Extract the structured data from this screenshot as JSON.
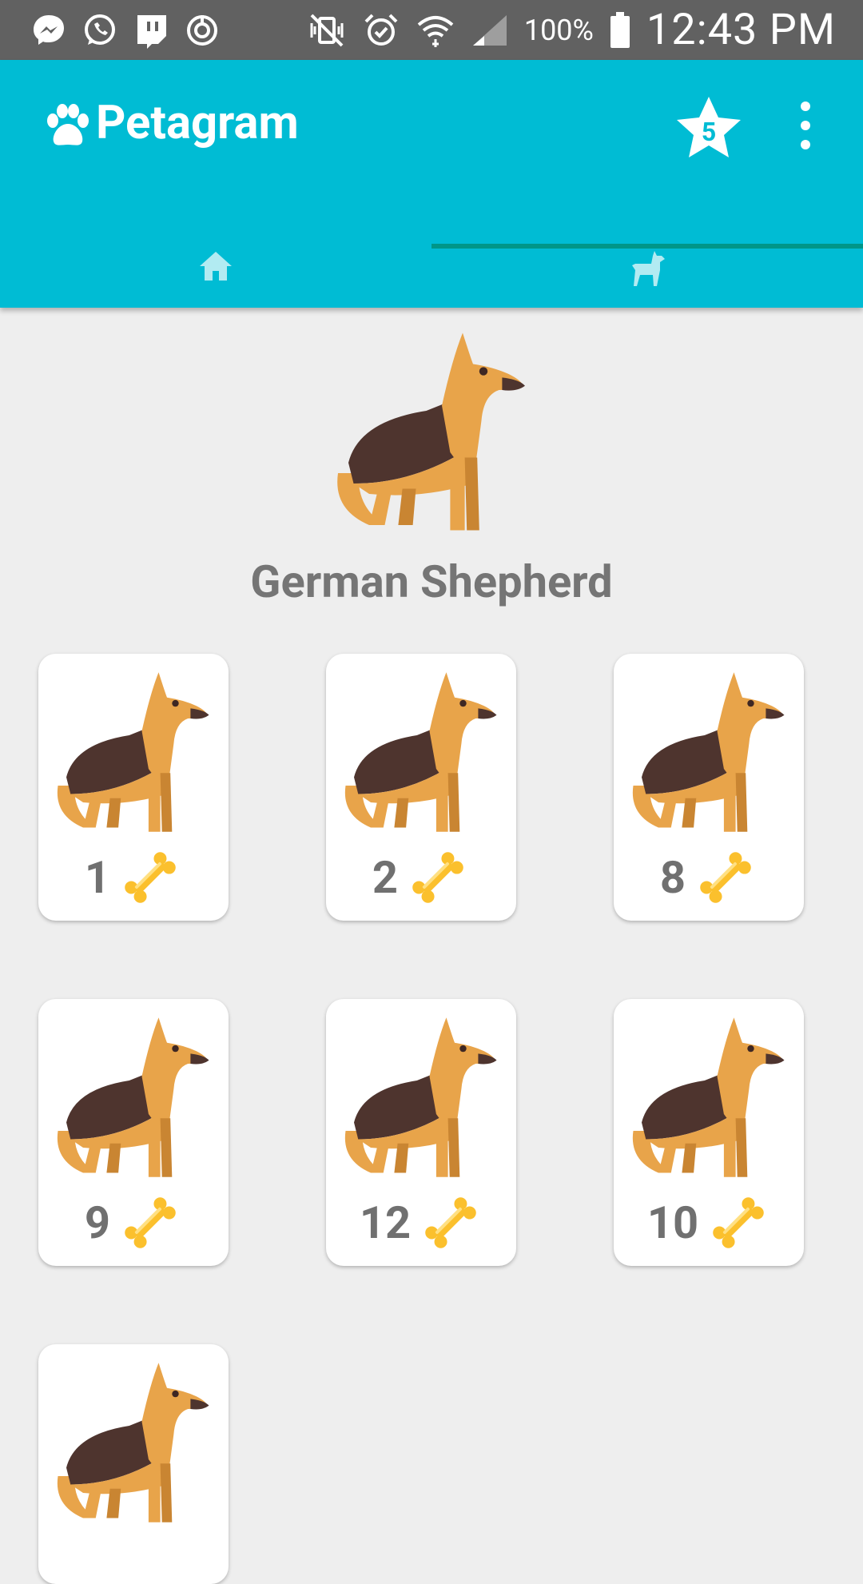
{
  "status_bar": {
    "battery": "100%",
    "time": "12:43 PM"
  },
  "app": {
    "title": "Petagram",
    "favorites_count": "5"
  },
  "tabs": [
    {
      "icon": "home-icon"
    },
    {
      "icon": "dog-icon"
    }
  ],
  "profile": {
    "name": "German Shepherd"
  },
  "grid": [
    {
      "likes": "1"
    },
    {
      "likes": "2"
    },
    {
      "likes": "8"
    },
    {
      "likes": "9"
    },
    {
      "likes": "12"
    },
    {
      "likes": "10"
    },
    {
      "likes": ""
    }
  ],
  "colors": {
    "primary": "#00bcd4",
    "accent": "#009688",
    "status_bar": "#616161",
    "background": "#eeeeee"
  }
}
